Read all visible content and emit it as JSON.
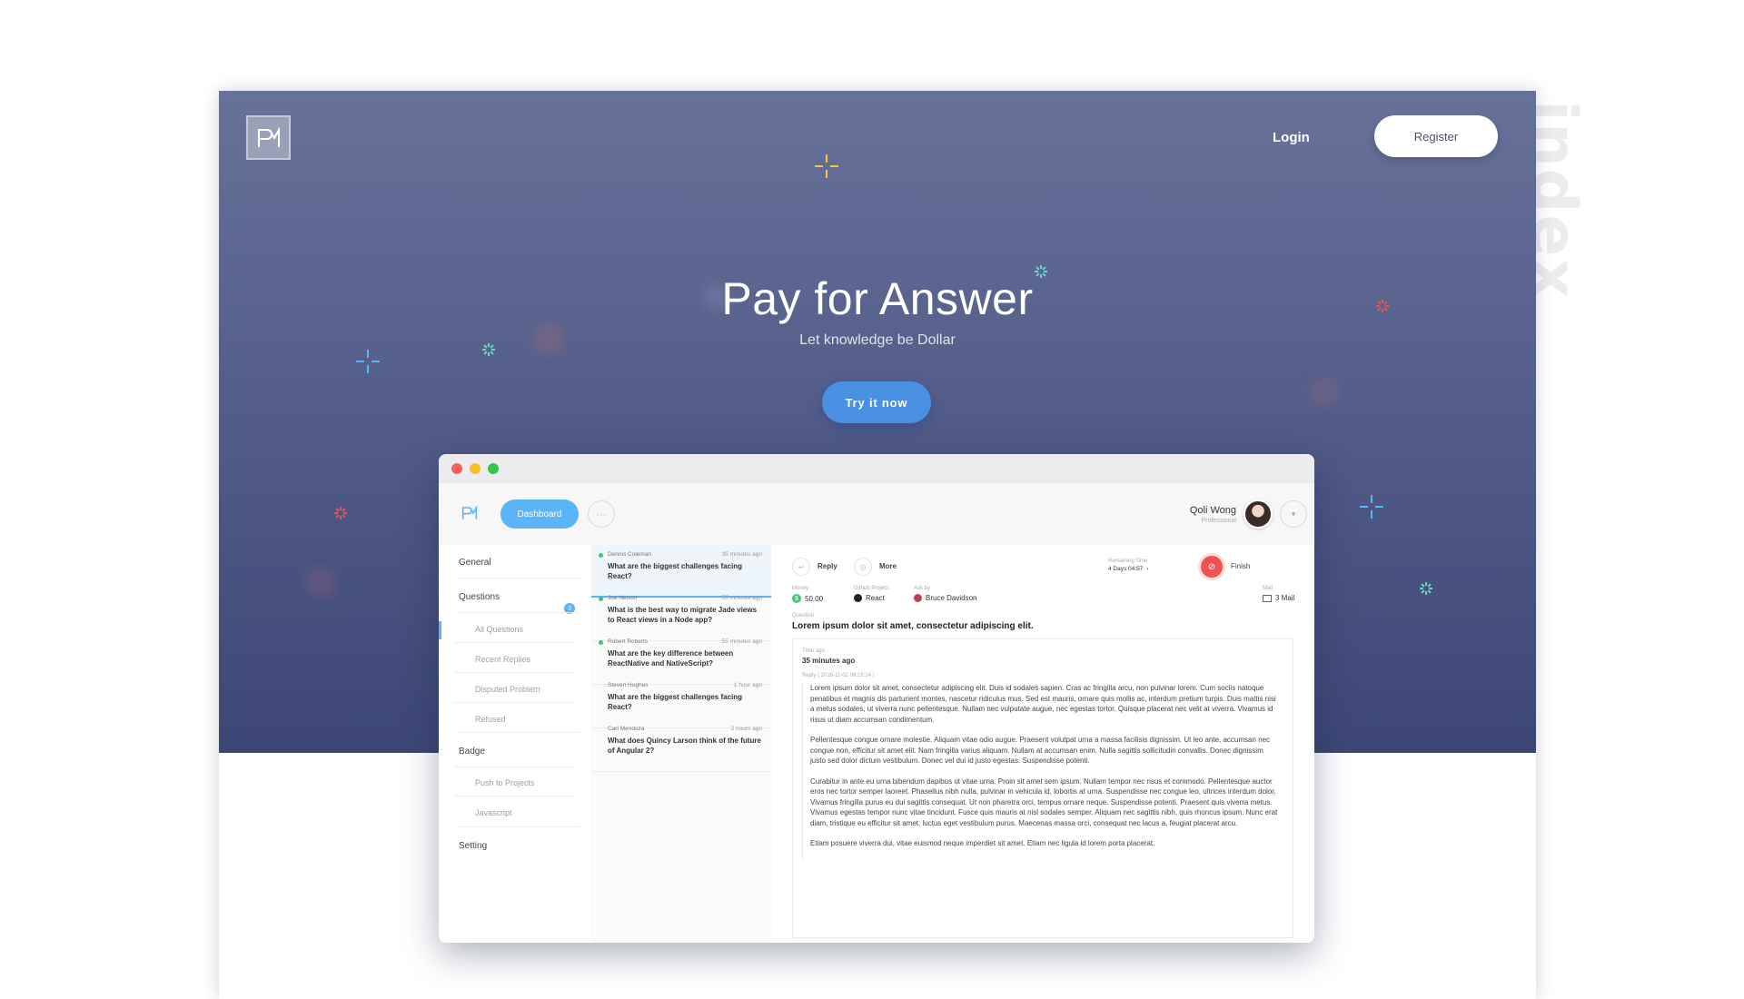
{
  "page_label": "index",
  "nav": {
    "login": "Login",
    "register": "Register"
  },
  "hero": {
    "title": "Pay for Answer",
    "subtitle": "Let knowledge be Dollar",
    "cta": "Try it now"
  },
  "mockup": {
    "dashboard_label": "Dashboard",
    "more_glyph": "···",
    "user": {
      "name": "Qoli Wong",
      "role": "Professional"
    },
    "sidebar": {
      "general": "General",
      "questions": "Questions",
      "questions_badge": "3",
      "all_questions": "All Questions",
      "recent_replies": "Recent Replies",
      "disputed_problem": "Disputed Problem",
      "refused": "Refused",
      "badge": "Badge",
      "push_to_projects": "Push to Projects",
      "javascript": "Javascript",
      "setting": "Setting"
    },
    "questions": [
      {
        "author": "Dennis Coleman",
        "time": "35 minutes ago",
        "text": "What are the biggest challenges facing React?"
      },
      {
        "author": "Joe Nelson",
        "time": "55 minutes ago",
        "text": "What is the best way to migrate Jade views to React views in a Node app?"
      },
      {
        "author": "Robert Roberts",
        "time": "55 minutes ago",
        "text": "What are the key difference between ReactNative and NativeScript?"
      },
      {
        "author": "Steven Hughes",
        "time": "1 hour ago",
        "text": "What are the biggest challenges facing React?"
      },
      {
        "author": "Carl Mendoza",
        "time": "2 hours ago",
        "text": "What does Quincy Larson think of the future of Angular 2?"
      }
    ],
    "detail": {
      "reply_label": "Reply",
      "more_label": "More",
      "remaining_label": "Remaining Time",
      "remaining_value": "4 Days 04:57",
      "finish_label": "Finish",
      "money_label": "Money",
      "money_value": "50.00",
      "github_label": "Github Project",
      "github_value": "React",
      "ask_label": "Ask by",
      "ask_value": "Bruce Davidson",
      "mail_label": "Mail",
      "mail_value": "3 Mail",
      "question_label": "Question",
      "question_text": "Lorem ipsum dolor sit amet, consectetur adipiscing elit.",
      "time_ago_label": "Time ago",
      "time_ago_value": "35 minutes ago",
      "reply_stamp": "Reply ( 2016-11-02 08:15:14 )",
      "paragraphs": [
        "Lorem ipsum dolor sit amet, consectetur adipiscing elit. Duis id sodales sapien. Cras ac fringilla arcu, non pulvinar lorem. Cum sociis natoque penatibus et magnis dis parturient montes, nascetur ridiculus mus. Sed est mauris, ornare quis mollis ac, interdum pretium turpis. Duis mattis nisi a metus sodales, ut viverra nunc pellentesque. Nullam nec vulputate augue, nec egestas tortor. Quisque placerat nec velit at viverra. Vivamus id risus ut diam accumsan condimentum.",
        "Pellentesque congue ornare molestie. Aliquam vitae odio augue. Praesent volutpat urna a massa facilisis dignissim. Ut leo ante, accumsan nec congue non, efficitur sit amet elit. Nam fringilla varius aliquam. Nullam at accumsan enim. Nulla sagittis sollicitudin convallis. Donec dignissim justo sed dolor dictum vestibulum. Donec vel dui id justo egestas. Suspendisse potenti.",
        "Curabitur in ante eu urna bibendum dapibus ut vitae urna. Proin sit amet sem ipsum. Nullam tempor nec risus et commodo. Pellentesque auctor eros nec tortor semper laoreet. Phasellus nibh nulla, pulvinar in vehicula id, lobortis at urna. Suspendisse nec congue leo, ultrices interdum dolor. Vivamus fringilla purus eu dui sagittis consequat. Ut non pharetra orci, tempus ornare neque. Suspendisse potenti. Praesent quis viverra metus. Vivamus egestas tempor nunc vitae tincidunt. Fusce quis mauris at nisl sodales semper. Aliquam nec sagittis nibh, quis rhoncus ipsum. Nunc erat diam, tristique eu efficitur sit amet, luctus eget vestibulum purus. Maecenas massa orci, consequat nec lacus a, feugiat placerat arcu.",
        "Etiam posuere viverra dui, vitae euismod neque imperdiet sit amet. Etiam nec ligula id lorem porta placerat."
      ]
    }
  },
  "colors": {
    "hero_top": "#67729a",
    "hero_bottom": "#3c4776",
    "cta": "#4a90e2",
    "accent": "#5ab4f5",
    "finish": "#ef5350",
    "online": "#3cc96d"
  }
}
